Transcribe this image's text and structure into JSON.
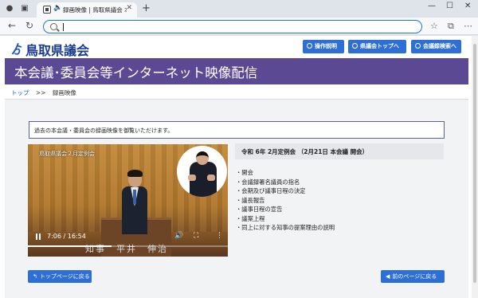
{
  "browser": {
    "tab_title": "録画映像 | 鳥取県議会 本会議",
    "new_tab": "+",
    "url": "",
    "window_controls": [
      "—",
      "☐",
      "✕"
    ]
  },
  "header": {
    "logo_mark": "ゟ",
    "logo_text": "鳥取県議会",
    "buttons": [
      {
        "label": "操作説明",
        "icon": "settings-icon"
      },
      {
        "label": "県議会トップへ",
        "icon": "home-icon"
      },
      {
        "label": "会議録検索へ",
        "icon": "search-icon"
      }
    ]
  },
  "banner": {
    "title": "本会議･委員会等インターネット映像配信"
  },
  "breadcrumb": {
    "home": "トップ",
    "separator": ">>",
    "current": "録画映像"
  },
  "notice": "過去の本会議・委員会の録画映像を御覧いただけます。",
  "video": {
    "caption": "鳥取県議会２月定例会",
    "nameplate": "知事　平井　伸治",
    "time": "7:06 / 16:54",
    "progress": 0.42
  },
  "meeting": {
    "title": "令和 6年 2月定例会 （2月21日 本会議 開会）",
    "agenda": [
      "・開会",
      "・会議録署名議員の指名",
      "・会期及び議事日程の決定",
      "・議長報告",
      "・議事日程の宣告",
      "・議案上程",
      "・同上に対する知事の提案理由の説明"
    ]
  },
  "footer": {
    "back_top": "トップページに戻る",
    "back_prev": "前のページに戻る"
  },
  "colors": {
    "banner": "#5b4a93",
    "button": "#2d6fd6",
    "logo": "#1a3e8c"
  }
}
